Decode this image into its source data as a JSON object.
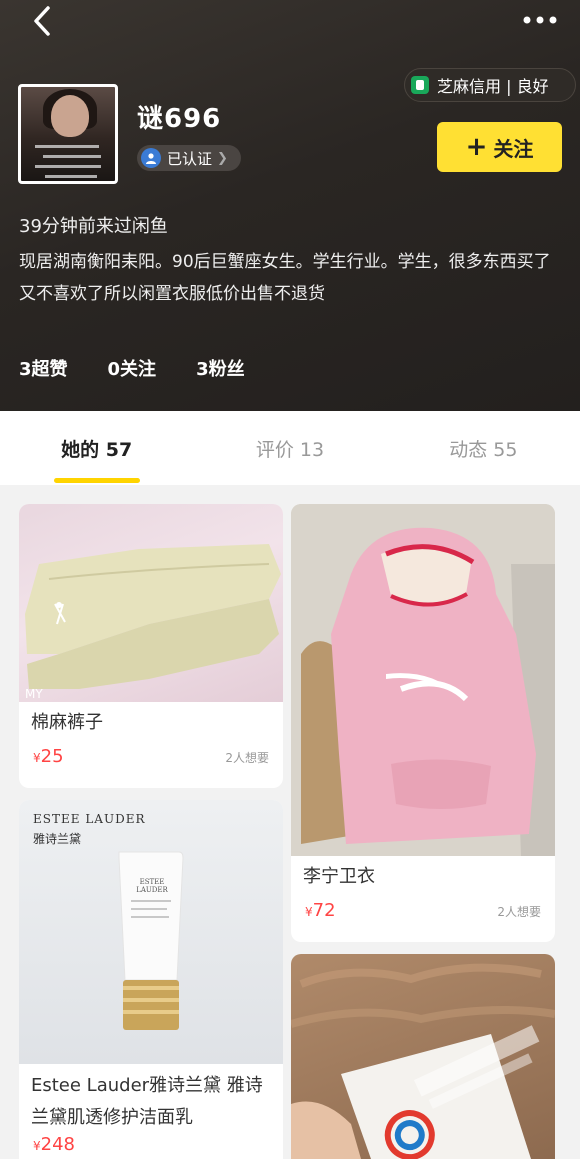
{
  "nav": {
    "back_icon": "chevron-left-icon",
    "more_icon": "more-dots-icon"
  },
  "profile": {
    "credit_badge": "芝麻信用 | 良好",
    "username": "谜696",
    "verified_label": "已认证",
    "follow_label": "关注",
    "last_seen": "39分钟前来过闲鱼",
    "bio": "现居湖南衡阳耒阳。90后巨蟹座女生。学生行业。学生，很多东西买了又不喜欢了所以闲置衣服低价出售不退货",
    "stats": [
      {
        "label": "3超赞"
      },
      {
        "label": "0关注"
      },
      {
        "label": "3粉丝"
      }
    ]
  },
  "tabs": [
    {
      "label": "她的 57"
    },
    {
      "label": "评价 13"
    },
    {
      "label": "动态 55"
    }
  ],
  "items": [
    {
      "title": "棉麻裤子",
      "price_symbol": "¥",
      "price": "25",
      "want": "2人想要"
    },
    {
      "title": "李宁卫衣",
      "price_symbol": "¥",
      "price": "72",
      "want": "2人想要"
    },
    {
      "title": "Estee Lauder雅诗兰黛 雅诗兰黛肌透修护洁面乳",
      "price_symbol": "¥",
      "price": "248",
      "want": "",
      "product_brand": "ESTEE LAUDER",
      "product_brand_cn": "雅诗兰黛",
      "tube_text": "ESTEE LAUDER"
    },
    {
      "title": "",
      "price": "",
      "want": ""
    }
  ],
  "colors": {
    "accent": "#ffe033",
    "price": "#ff4444"
  }
}
